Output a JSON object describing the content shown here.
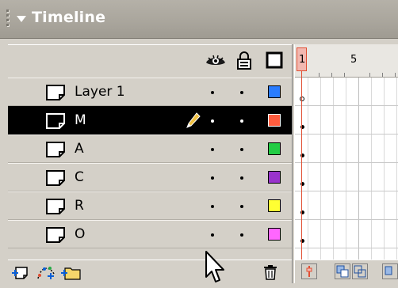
{
  "panel": {
    "title": "Timeline",
    "icons": [
      "panel-grip-icon",
      "collapse-arrow-icon"
    ]
  },
  "columns": {
    "icons": [
      "eye-icon",
      "lock-icon",
      "outline-icon"
    ]
  },
  "layers": [
    {
      "name": "Layer 1",
      "selected": false,
      "editing": false,
      "color": "#2a7cff"
    },
    {
      "name": "M",
      "selected": true,
      "editing": true,
      "color": "#ff5c3e"
    },
    {
      "name": "A",
      "selected": false,
      "editing": false,
      "color": "#22cc44"
    },
    {
      "name": "C",
      "selected": false,
      "editing": false,
      "color": "#9933cc"
    },
    {
      "name": "R",
      "selected": false,
      "editing": false,
      "color": "#ffff33"
    },
    {
      "name": "O",
      "selected": false,
      "editing": false,
      "color": "#ff66ff"
    }
  ],
  "frames": {
    "ruler_labels": [
      "1",
      "5"
    ],
    "current_frame": 1
  },
  "bottom_buttons": [
    "insert-layer-icon",
    "add-motion-guide-icon",
    "insert-layer-folder-icon",
    "delete-layer-icon"
  ],
  "frame_buttons": [
    "center-frame-icon",
    "onion-skin-icon",
    "onion-skin-outlines-icon"
  ],
  "colors": {
    "header_bg": "#a9a59c",
    "panel_bg": "#d4d0c8",
    "playhead": "#e14f33",
    "selected_row": "#000000"
  }
}
